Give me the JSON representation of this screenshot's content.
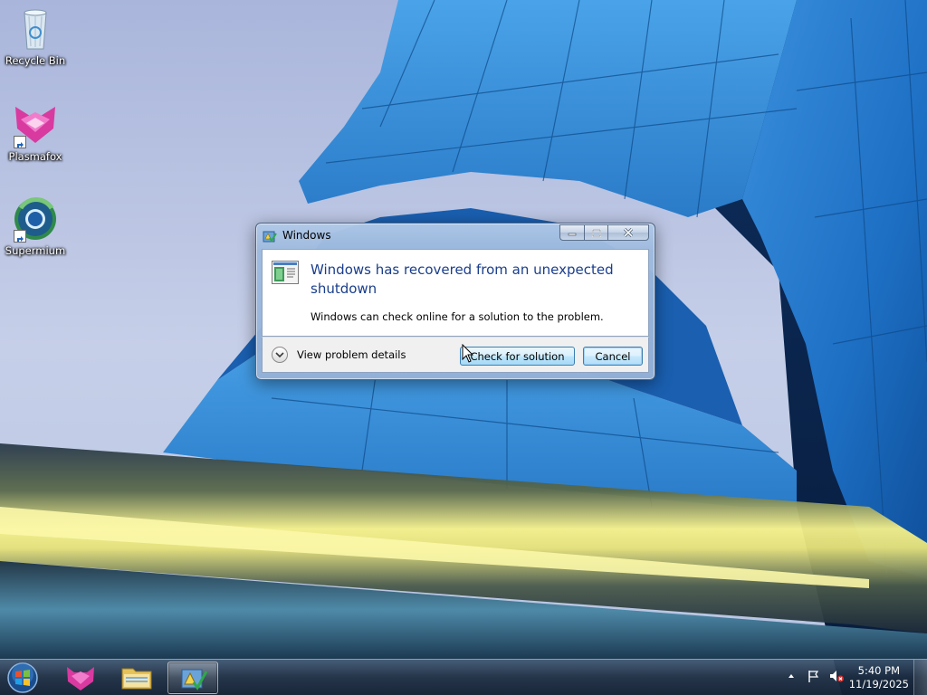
{
  "desktop": {
    "icons": [
      {
        "label": "Recycle Bin"
      },
      {
        "label": "Plasmafox"
      },
      {
        "label": "Supermium"
      }
    ]
  },
  "dialog": {
    "title": "Windows",
    "main_instruction": "Windows has recovered from an unexpected shutdown",
    "secondary_text": "Windows can check online for a solution to the problem.",
    "details_label": "View problem details",
    "check_button": "Check for solution",
    "cancel_button": "Cancel",
    "caption_buttons": [
      "minimize-icon",
      "maximize-icon",
      "close-icon"
    ]
  },
  "taskbar": {
    "pinned": [
      "start-orb-icon",
      "plasmafox-icon",
      "explorer-folder-icon",
      "problem-reporting-icon"
    ],
    "clock_time": "5:40 PM",
    "clock_date": "11/19/2025",
    "tray_icons": [
      "show-hidden-icons-chevron",
      "action-center-flag-icon",
      "volume-muted-icon"
    ]
  },
  "colors": {
    "accent": "#1a3e8c",
    "taskbar": "#1c2c40",
    "dialog_frame": "#9fbadf"
  }
}
